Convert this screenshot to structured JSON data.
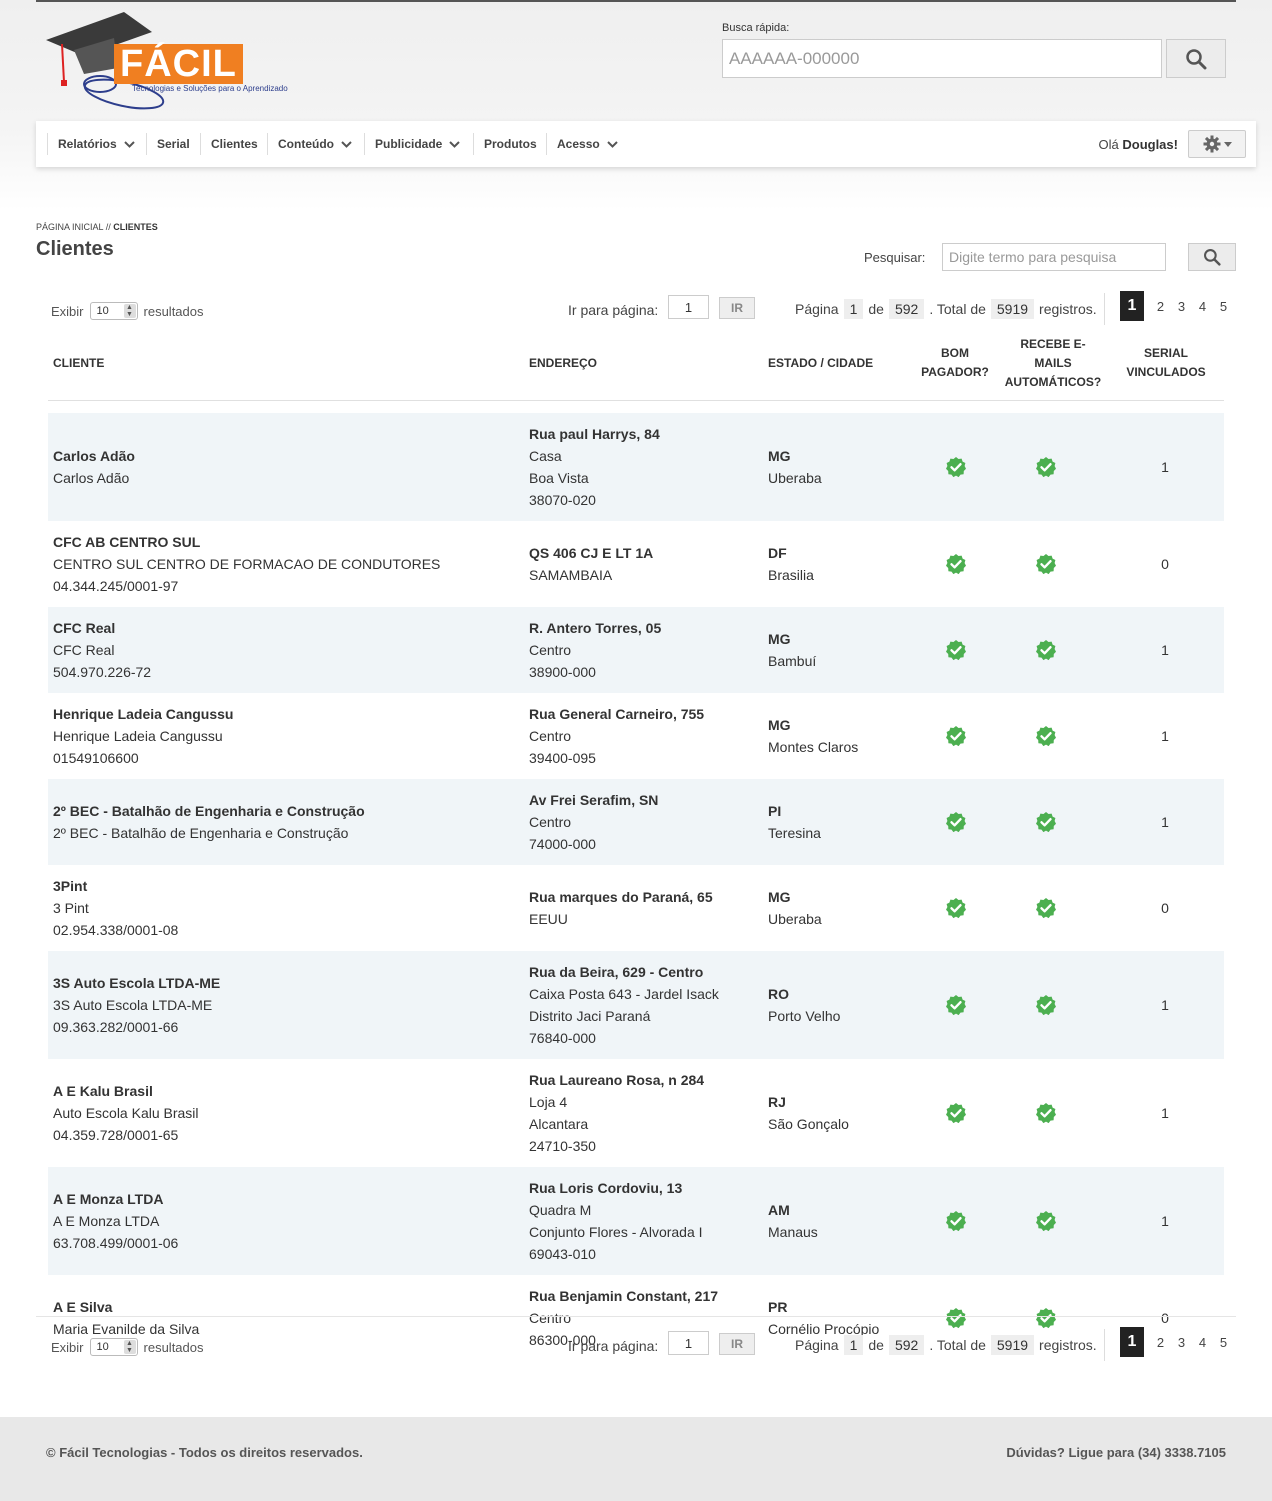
{
  "brand": {
    "logo_text": "FÁCIL",
    "tagline": "Tecnologias e Soluções para o Aprendizado",
    "colors": {
      "orange": "#f07f21",
      "navy": "#2d3e8c",
      "check_green": "#4caf50",
      "dark": "#222222"
    }
  },
  "quick_search": {
    "label": "Busca rápida:",
    "placeholder": "AAAAAA-000000",
    "icon": "search-icon"
  },
  "nav": {
    "items": [
      {
        "label": "Relatórios",
        "dropdown": true
      },
      {
        "label": "Serial",
        "dropdown": false
      },
      {
        "label": "Clientes",
        "dropdown": false
      },
      {
        "label": "Conteúdo",
        "dropdown": true
      },
      {
        "label": "Publicidade",
        "dropdown": true
      },
      {
        "label": "Produtos",
        "dropdown": false
      },
      {
        "label": "Acesso",
        "dropdown": true
      }
    ],
    "greeting_prefix": "Olá",
    "user_name": "Douglas",
    "greeting_suffix": "!",
    "settings_icon": "gear-icon"
  },
  "breadcrumb": {
    "home": "PÁGINA INICIAL",
    "separator": " // ",
    "current": "CLIENTES"
  },
  "page_title": "Clientes",
  "search": {
    "label": "Pesquisar:",
    "placeholder": "Digite termo para pesquisa"
  },
  "pager": {
    "show_label": "Exibir",
    "per_page": "10",
    "results_label": "resultados",
    "goto_label": "Ir para página:",
    "goto_value": "1",
    "go_button": "IR",
    "page_label": "Página",
    "current_page": "1",
    "of_label": "de",
    "total_pages": "592",
    "total_label": ". Total de",
    "total_records": "5919",
    "records_label": "registros.",
    "pages": [
      "1",
      "2",
      "3",
      "4",
      "5"
    ]
  },
  "table": {
    "headers": {
      "client": "CLIENTE",
      "address": "ENDEREÇO",
      "state_city": "ESTADO / CIDADE",
      "good_payer": [
        "BOM",
        "PAGADOR?"
      ],
      "auto_emails": [
        "RECEBE E-",
        "MAILS",
        "AUTOMÁTICOS?"
      ],
      "serial": [
        "SERIAL",
        "VINCULADOS"
      ]
    },
    "rows": [
      {
        "name": "Carlos Adão",
        "client_lines": [
          "Carlos Adão"
        ],
        "street": "Rua paul Harrys, 84",
        "addr_lines": [
          "Casa",
          "Boa Vista",
          "38070-020"
        ],
        "state": "MG",
        "city": "Uberaba",
        "good_payer": true,
        "auto_emails": true,
        "serials": "1"
      },
      {
        "name": "CFC AB CENTRO SUL",
        "client_lines": [
          "CENTRO SUL CENTRO DE FORMACAO DE CONDUTORES",
          "04.344.245/0001-97"
        ],
        "street": "QS 406 CJ E LT 1A",
        "addr_lines": [
          "SAMAMBAIA"
        ],
        "state": "DF",
        "city": "Brasilia",
        "good_payer": true,
        "auto_emails": true,
        "serials": "0"
      },
      {
        "name": "CFC Real",
        "client_lines": [
          "CFC Real",
          "504.970.226-72"
        ],
        "street": "R. Antero Torres, 05",
        "addr_lines": [
          "Centro",
          "38900-000"
        ],
        "state": "MG",
        "city": "Bambuí",
        "good_payer": true,
        "auto_emails": true,
        "serials": "1"
      },
      {
        "name": "Henrique Ladeia Cangussu",
        "client_lines": [
          "Henrique Ladeia Cangussu",
          "01549106600"
        ],
        "street": "Rua General Carneiro, 755",
        "addr_lines": [
          "Centro",
          "39400-095"
        ],
        "state": "MG",
        "city": "Montes Claros",
        "good_payer": true,
        "auto_emails": true,
        "serials": "1"
      },
      {
        "name": "2º BEC - Batalhão de Engenharia e Construção",
        "client_lines": [
          "2º BEC - Batalhão de Engenharia e Construção"
        ],
        "street": "Av Frei Serafim, SN",
        "addr_lines": [
          "Centro",
          "74000-000"
        ],
        "state": "PI",
        "city": "Teresina",
        "good_payer": true,
        "auto_emails": true,
        "serials": "1"
      },
      {
        "name": "3Pint",
        "client_lines": [
          "3 Pint",
          "02.954.338/0001-08"
        ],
        "street": "Rua marques do Paraná, 65",
        "addr_lines": [
          "EEUU"
        ],
        "state": "MG",
        "city": "Uberaba",
        "good_payer": true,
        "auto_emails": true,
        "serials": "0"
      },
      {
        "name": "3S Auto Escola LTDA-ME",
        "client_lines": [
          "3S Auto Escola LTDA-ME",
          "09.363.282/0001-66"
        ],
        "street": "Rua da Beira, 629 - Centro",
        "addr_lines": [
          "Caixa Posta 643 - Jardel Isack",
          "Distrito Jaci Paraná",
          "76840-000"
        ],
        "state": "RO",
        "city": "Porto Velho",
        "good_payer": true,
        "auto_emails": true,
        "serials": "1"
      },
      {
        "name": "A E Kalu Brasil",
        "client_lines": [
          "Auto Escola Kalu Brasil",
          "04.359.728/0001-65"
        ],
        "street": "Rua Laureano Rosa, n 284",
        "addr_lines": [
          "Loja 4",
          "Alcantara",
          "24710-350"
        ],
        "state": "RJ",
        "city": "São Gonçalo",
        "good_payer": true,
        "auto_emails": true,
        "serials": "1"
      },
      {
        "name": "A E Monza LTDA",
        "client_lines": [
          "A E Monza LTDA",
          "63.708.499/0001-06"
        ],
        "street": "Rua Loris Cordoviu, 13",
        "addr_lines": [
          "Quadra M",
          "Conjunto Flores - Alvorada I",
          "69043-010"
        ],
        "state": "AM",
        "city": "Manaus",
        "good_payer": true,
        "auto_emails": true,
        "serials": "1"
      },
      {
        "name": "A E Silva",
        "client_lines": [
          "Maria Evanilde da Silva"
        ],
        "street": "Rua Benjamin Constant, 217",
        "addr_lines": [
          "Centro",
          "86300-000"
        ],
        "state": "PR",
        "city": "Cornélio Procópio",
        "good_payer": true,
        "auto_emails": true,
        "serials": "0"
      }
    ]
  },
  "footer": {
    "copyright": "© Fácil Tecnologias - Todos os direitos reservados.",
    "phone_text": "Dúvidas? Ligue para (34) 3338.7105"
  }
}
